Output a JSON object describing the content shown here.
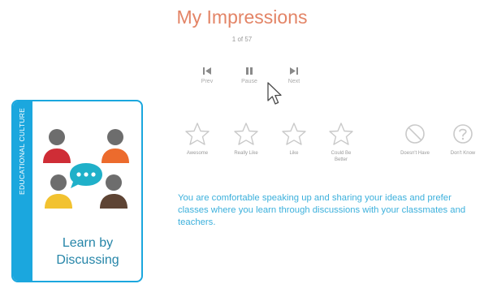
{
  "header": {
    "title": "My Impressions",
    "counter": "1 of 57"
  },
  "controls": {
    "prev": "Prev",
    "pause": "Pause",
    "next": "Next"
  },
  "ratings": [
    {
      "label": "Awesome",
      "icon": "star-icon"
    },
    {
      "label": "Really Like",
      "icon": "star-icon"
    },
    {
      "label": "Like",
      "icon": "star-icon"
    },
    {
      "label": "Could Be Better",
      "icon": "star-icon"
    },
    {
      "label": "Doesn't Have",
      "icon": "prohibited-icon"
    },
    {
      "label": "Don't Know",
      "icon": "question-icon"
    }
  ],
  "card": {
    "side_label": "EDUCATIONAL CULTURE",
    "caption_line1": "Learn by",
    "caption_line2": "Discussing",
    "art_icon": "group-discussion-icon"
  },
  "description": "You are comfortable speaking up and sharing your ideas and prefer classes where you learn through discussions with your classmates and teachers.",
  "colors": {
    "title": "#e38466",
    "accent": "#1ba7de",
    "text_blue": "#3cb0dc"
  }
}
